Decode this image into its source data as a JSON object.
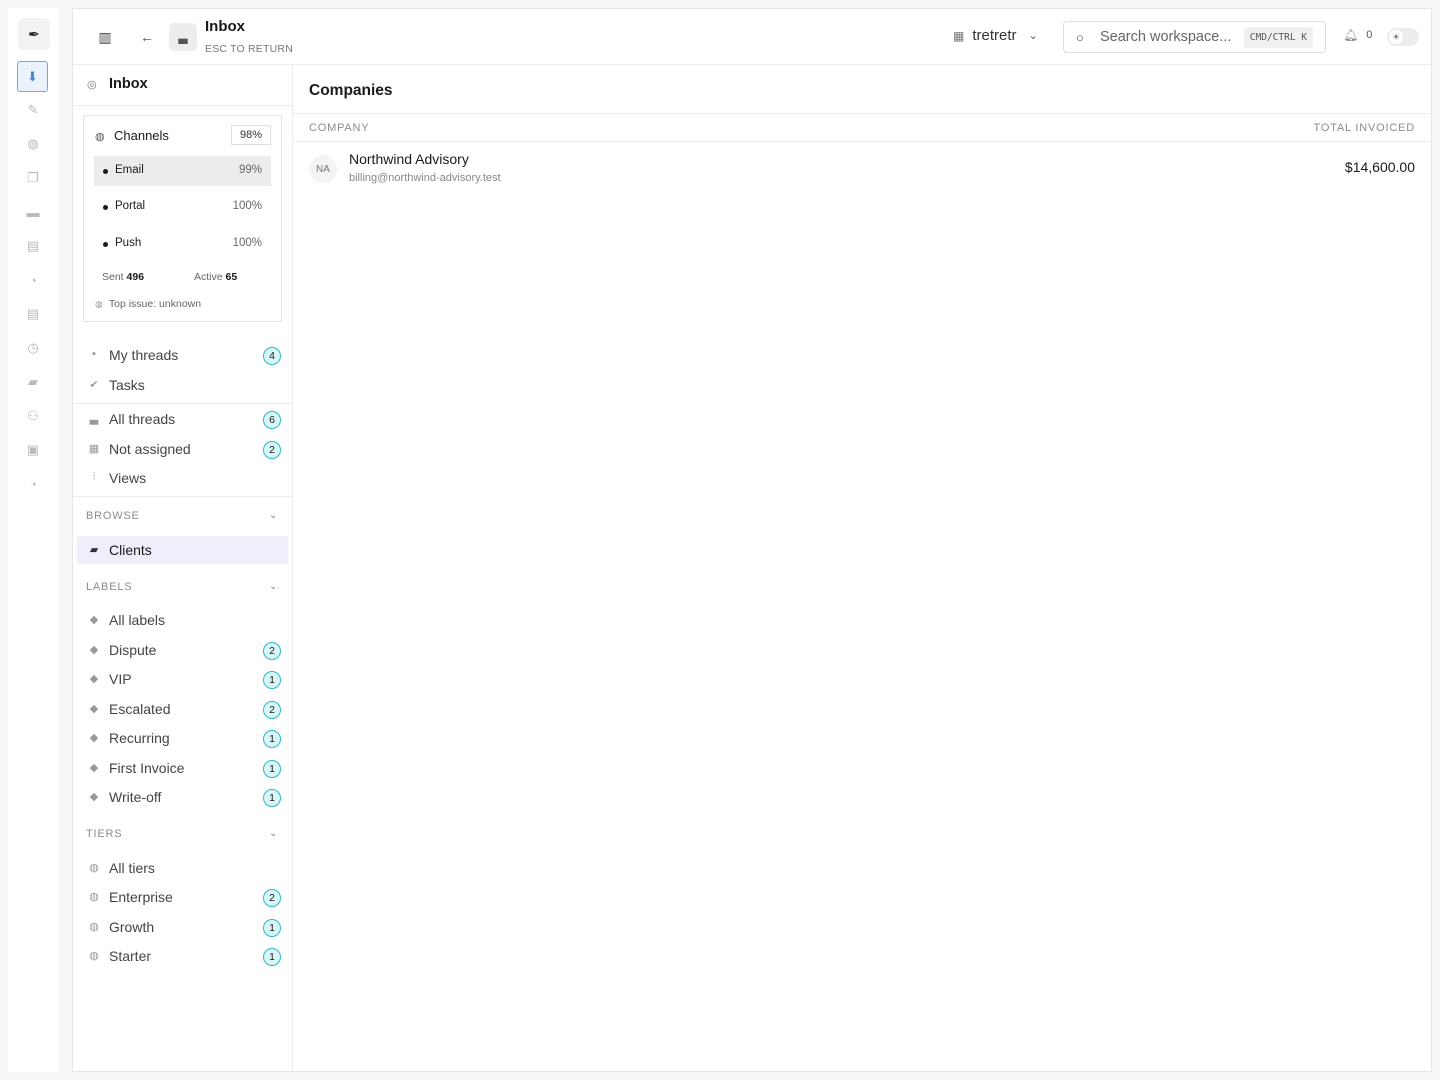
{
  "rail": {
    "logo_icon": "feather-icon",
    "items": [
      "inbox-icon",
      "tools-icon",
      "globe-icon",
      "copy-icon",
      "card-icon",
      "invoice-icon",
      "bell-icon",
      "report-icon",
      "clock-icon",
      "folder-icon",
      "users-icon",
      "archive-icon",
      "bell-icon"
    ]
  },
  "topbar": {
    "title": "Inbox",
    "subtitle": "ESC TO RETURN",
    "workspace": "tretretr",
    "search_placeholder": "Search workspace...",
    "shortcut": "CMD/CTRL K",
    "notifications": "0"
  },
  "sidebar": {
    "header": "Inbox",
    "channels": {
      "title": "Channels",
      "overall": "98%",
      "items": [
        {
          "name": "Email",
          "value": "99%"
        },
        {
          "name": "Portal",
          "value": "100%"
        },
        {
          "name": "Push",
          "value": "100%"
        }
      ],
      "sent_label": "Sent",
      "sent_value": "496",
      "active_label": "Active",
      "active_value": "65",
      "top_issue": "Top issue: unknown"
    },
    "nav1": [
      {
        "label": "My threads",
        "badge": "4"
      },
      {
        "label": "Tasks",
        "badge": ""
      }
    ],
    "nav2": [
      {
        "label": "All threads",
        "badge": "6"
      },
      {
        "label": "Not assigned",
        "badge": "2"
      },
      {
        "label": "Views",
        "badge": ""
      }
    ],
    "browse_title": "BROWSE",
    "browse": [
      {
        "label": "Clients"
      }
    ],
    "labels_title": "LABELS",
    "labels": [
      {
        "label": "All labels",
        "badge": ""
      },
      {
        "label": "Dispute",
        "badge": "2"
      },
      {
        "label": "VIP",
        "badge": "1"
      },
      {
        "label": "Escalated",
        "badge": "2"
      },
      {
        "label": "Recurring",
        "badge": "1"
      },
      {
        "label": "First Invoice",
        "badge": "1"
      },
      {
        "label": "Write-off",
        "badge": "1"
      }
    ],
    "tiers_title": "TIERS",
    "tiers": [
      {
        "label": "All tiers",
        "badge": ""
      },
      {
        "label": "Enterprise",
        "badge": "2"
      },
      {
        "label": "Growth",
        "badge": "1"
      },
      {
        "label": "Starter",
        "badge": "1"
      }
    ]
  },
  "main": {
    "title": "Companies",
    "columns": {
      "company": "COMPANY",
      "total": "TOTAL INVOICED"
    },
    "rows": [
      {
        "initials": "NA",
        "name": "Northwind Advisory",
        "email": "billing@northwind-advisory.test",
        "total": "$14,600.00"
      }
    ]
  },
  "colors": {
    "accent_badge_border": "#2cb8c8",
    "accent_badge_bg": "#d9f6f9",
    "active_nav_bg": "#f0eefb",
    "rail_active": "#4a86c7"
  }
}
